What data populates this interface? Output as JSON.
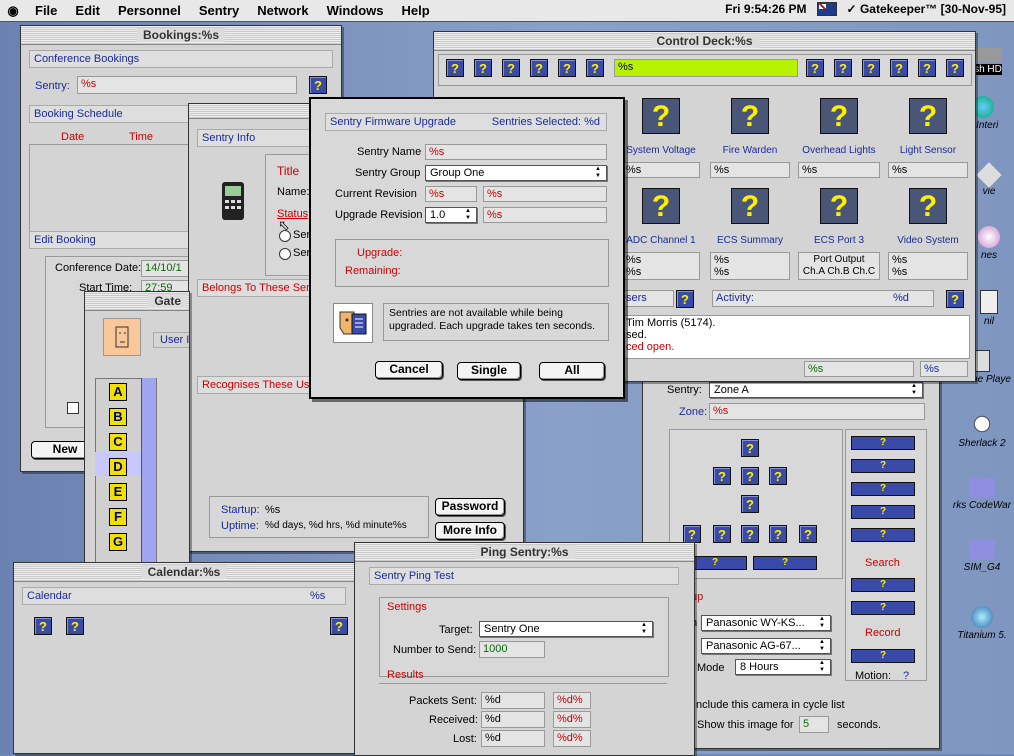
{
  "menubar": {
    "items": [
      "File",
      "Edit",
      "Personnel",
      "Sentry",
      "Network",
      "Windows",
      "Help"
    ],
    "clock": "Fri 9:54:26 PM",
    "app": "Gatekeeper™ [30-Nov-95]"
  },
  "desktop": {
    "icons": [
      "sh HD",
      "e Interi",
      "vie",
      "nes",
      "nil",
      "ckTime Playe",
      "Sherlack 2",
      "rks CodeWar",
      "SIM_G4",
      "Titanium 5."
    ]
  },
  "bookings": {
    "title": "Bookings:%s",
    "conference": "Conference Bookings",
    "sentry_label": "Sentry:",
    "sentry_value": "%s",
    "schedule": "Booking Schedule",
    "col_date": "Date",
    "col_time": "Time",
    "edit": "Edit Booking",
    "conf_date_label": "Conference Date:",
    "conf_date": "14/10/1",
    "start_label": "Start Time:",
    "start": "27:59",
    "new": "New"
  },
  "sentryinfo": {
    "title": "Sentry Info",
    "field_title": "Title",
    "name": "Name:",
    "status": "Status",
    "radio1": "Ser",
    "radio2": "Ser",
    "belongs": "Belongs To These Sen",
    "recognises": "Recognises These Use",
    "startup_label": "Startup:",
    "startup": "%s",
    "uptime_label": "Uptime:",
    "uptime": "%d days, %d hrs, %d minute%s",
    "password": "Password",
    "moreinfo": "More Info"
  },
  "gate": {
    "title": "Gate",
    "user": "User I",
    "letters": [
      "A",
      "B",
      "C",
      "D",
      "E",
      "F",
      "G"
    ]
  },
  "calendar": {
    "title": "Calendar:%s",
    "header": "Calendar",
    "value": "%s"
  },
  "control": {
    "title": "Control Deck:%s",
    "status": "%s",
    "tiles": [
      {
        "label": "System Voltage",
        "v": "%s"
      },
      {
        "label": "Fire Warden",
        "v": "%s"
      },
      {
        "label": "Overhead Lights",
        "v": "%s"
      },
      {
        "label": "Light Sensor",
        "v": "%s"
      },
      {
        "label": "ADC Channel 1",
        "v": "%s\n%s"
      },
      {
        "label": "ECS Summary",
        "v": "%s\n%s"
      },
      {
        "label": "ECS Port 3",
        "v": "Port Output\nCh.A Ch.B Ch.C"
      },
      {
        "label": "Video System",
        "v": "%s\n%s"
      }
    ],
    "users": "sers",
    "activity_label": "Activity:",
    "activity": "%d",
    "log1": "Tim Morris (5174).",
    "log2": "sed.",
    "log3": "ced open.",
    "foot1": "%s",
    "foot2": "%s"
  },
  "camera": {
    "sentry_label": "Sentry:",
    "sentry": "Zone A",
    "zone_label": "Zone:",
    "zone": "%s",
    "search": "Search",
    "record": "Record",
    "motion_label": "Motion:",
    "motion": "?",
    "cam1": "Panasonic WY-KS...",
    "cam2": "Panasonic AG-67...",
    "mode_label": "Mode",
    "mode": "8 Hours",
    "setup": "up",
    "n": "n",
    "include": "Include this camera in cycle list",
    "show_label": "Show this image for",
    "show_val": "5",
    "seconds": "seconds."
  },
  "firmware": {
    "header": "Sentry Firmware Upgrade",
    "selected": "Sentries Selected: %d",
    "name_label": "Sentry Name",
    "name": "%s",
    "group_label": "Sentry Group",
    "group": "Group One",
    "current_label": "Current Revision",
    "current1": "%s",
    "current2": "%s",
    "upgrade_label": "Upgrade Revision",
    "upgrade_rev": "1.0",
    "upgrade_val": "%s",
    "upgrade": "Upgrade:",
    "remaining": "Remaining:",
    "message": "Sentries are not available while being upgraded.  Each upgrade takes ten seconds.",
    "cancel": "Cancel",
    "single": "Single",
    "all": "All"
  },
  "ping": {
    "title": "Ping Sentry:%s",
    "header": "Sentry Ping Test",
    "settings": "Settings",
    "target_label": "Target:",
    "target": "Sentry One",
    "number_label": "Number to Send:",
    "number": "1000",
    "results": "Results",
    "sent": "Packets Sent:",
    "received": "Received:",
    "lost": "Lost:",
    "d": "%d",
    "pct": "%d%"
  }
}
